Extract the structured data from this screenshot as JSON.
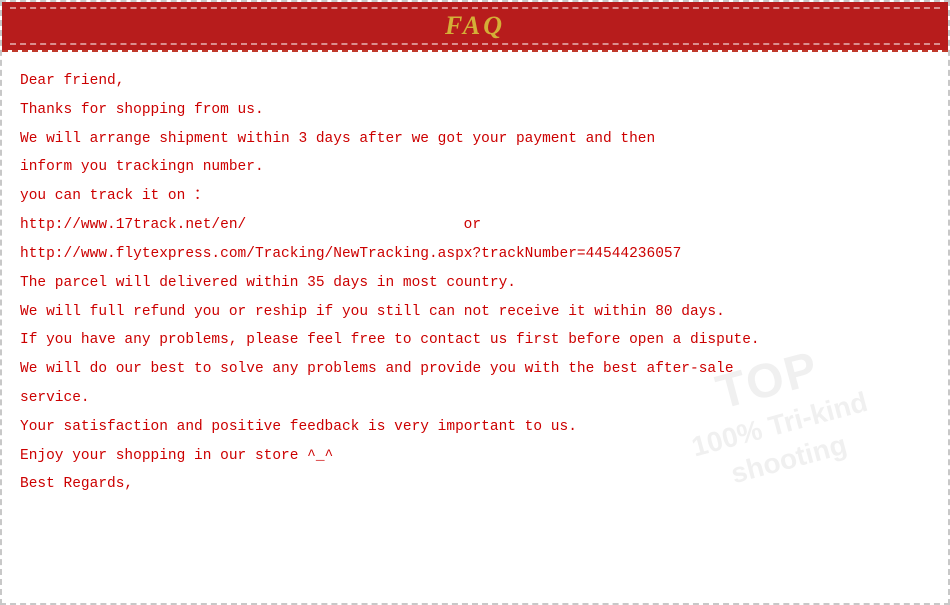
{
  "header": {
    "title": "FAQ",
    "bg_color": "#b71c1c",
    "title_color": "#d4af37"
  },
  "content": {
    "lines": [
      "Dear friend,",
      "Thanks for shopping from us.",
      "We will arrange shipment within 3 days after we got your payment and then",
      "inform you trackingn number.",
      "you can track it on ：",
      "http://www.17track.net/en/",
      "http://www.flytexpress.com/Tracking/NewTracking.aspx?trackNumber=44544236057",
      "The parcel will delivered within 35 days in most country.",
      "We will full refund you or reship if you still can not receive it within 80 days.",
      "If you have any problems, please feel free to contact us first before open a dispute.",
      "We will do our best to solve any problems and provide you with the best after-sale",
      "service.",
      "Your satisfaction and positive feedback is very important to us.",
      "Enjoy your shopping in our store ^_^",
      "Best Regards,"
    ],
    "or_text": "or",
    "tracking_url1": "http://www.17track.net/en/",
    "tracking_url2": "http://www.flytexpress.com/Tracking/NewTracking.aspx?trackNumber=44544236057"
  },
  "watermark": {
    "line1": "TOP",
    "line2": "100% Tri-kind",
    "line3": "shooting"
  }
}
